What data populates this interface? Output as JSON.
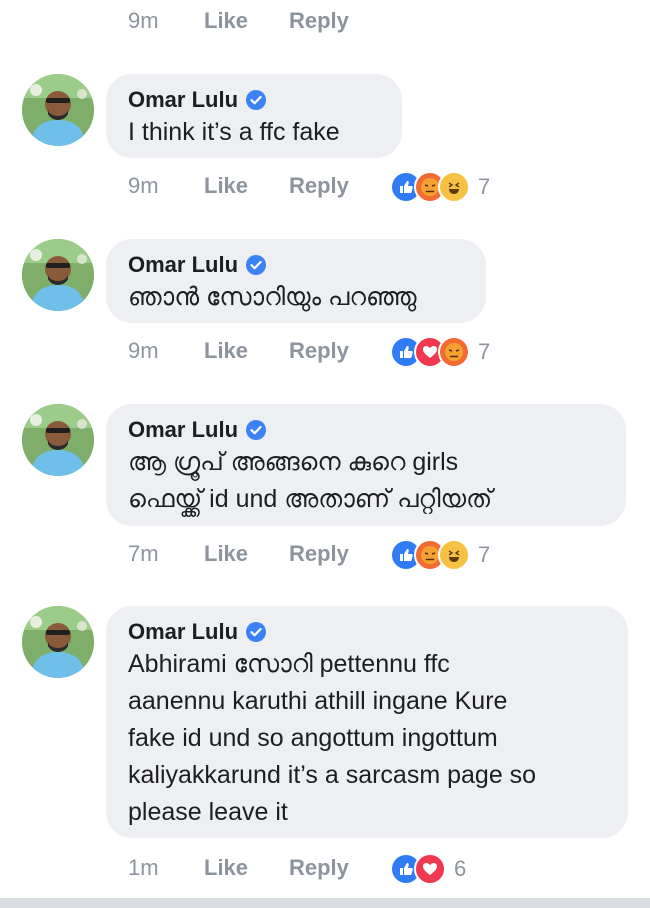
{
  "top": {
    "time": "9m",
    "like": "Like",
    "reply": "Reply"
  },
  "comments": [
    {
      "author": "Omar Lulu",
      "text": "I think it’s a ffc fake",
      "time": "9m",
      "like": "Like",
      "reply": "Reply",
      "reactions": [
        "like-icon",
        "angry-icon",
        "haha-icon"
      ],
      "reaction_count": "7"
    },
    {
      "author": "Omar Lulu",
      "text": "ഞാൻ സോറിയും പറഞ്ഞു",
      "time": "9m",
      "like": "Like",
      "reply": "Reply",
      "reactions": [
        "like-icon",
        "love-icon",
        "angry-icon"
      ],
      "reaction_count": "7"
    },
    {
      "author": "Omar Lulu",
      "text": "ആ ഗ്രൂപ് അങ്ങനെ കുറെ girls\nഫെയ്ക്ക് id und അതാണ് പറ്റിയത്",
      "time": "7m",
      "like": "Like",
      "reply": "Reply",
      "reactions": [
        "like-icon",
        "angry-icon",
        "haha-icon"
      ],
      "reaction_count": "7"
    },
    {
      "author": "Omar Lulu",
      "text": "Abhirami സോറി pettennu ffc\naanennu karuthi athill ingane Kure\nfake id und so angottum ingottum\nkaliyakkarund it’s a sarcasm page so\nplease leave it",
      "time": "1m",
      "like": "Like",
      "reply": "Reply",
      "reactions": [
        "like-icon",
        "love-icon"
      ],
      "reaction_count": "6"
    }
  ],
  "colors": {
    "like": "#2f7cf6",
    "love": "#f0384f",
    "angry": "#f26b33",
    "haha": "#f7c243",
    "bubble": "#eeeff2",
    "meta": "#8d949e",
    "verified": "#3b82f6"
  }
}
